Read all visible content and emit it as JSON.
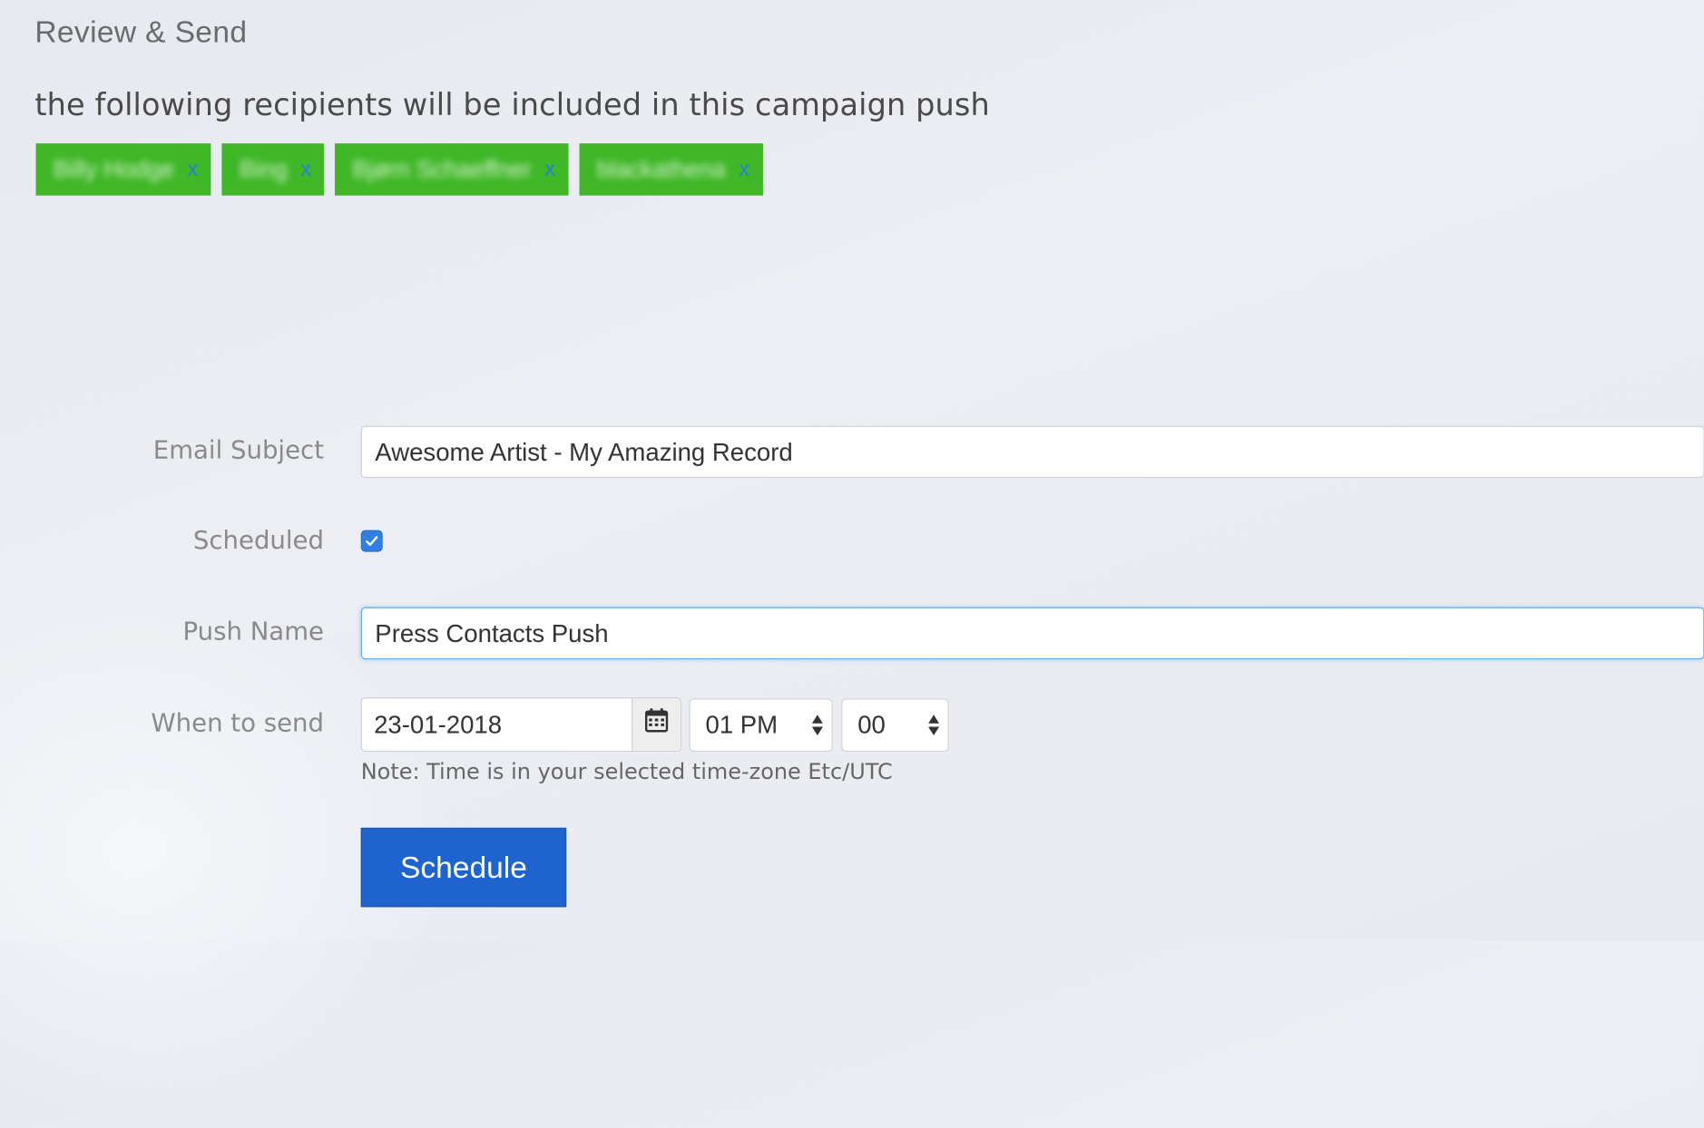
{
  "section_title": "Review & Send",
  "lead_text": "the following recipients will be included in this campaign push",
  "recipients": [
    {
      "name": "Billy Hodge",
      "remove": "x"
    },
    {
      "name": "Bing",
      "remove": "x"
    },
    {
      "name": "Bjørn Schaeffner",
      "remove": "x"
    },
    {
      "name": "blackathena",
      "remove": "x"
    }
  ],
  "form": {
    "email_subject": {
      "label": "Email Subject",
      "value": "Awesome Artist - My Amazing Record"
    },
    "scheduled": {
      "label": "Scheduled",
      "checked": true
    },
    "push_name": {
      "label": "Push Name",
      "value": "Press Contacts Push"
    },
    "when_to_send": {
      "label": "When to send",
      "date": "23-01-2018",
      "hour": "01 PM",
      "minute": "00",
      "note": "Note: Time is in your selected time-zone Etc/UTC"
    },
    "submit_label": "Schedule"
  },
  "icons": {
    "calendar": "calendar-icon",
    "checkmark": "checkmark-icon",
    "select_arrows": "sort-arrows-icon"
  },
  "colors": {
    "tag_bg": "#3fb727",
    "tag_remove": "#2a7fd8",
    "primary_button": "#1f63cf",
    "checkbox": "#2f7fe6",
    "focus_border": "#66afe9"
  }
}
